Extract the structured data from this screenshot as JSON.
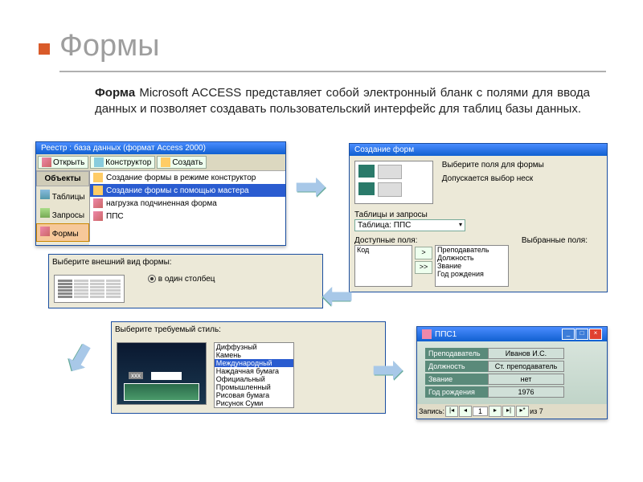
{
  "title": "Формы",
  "desc_bold": "Форма",
  "desc_rest": " Microsoft ACCESS представляет собой электронный бланк с полями для ввода данных и позволяет создавать пользовательский интерфейс для таблиц базы данных.",
  "db": {
    "title": "Реестр : база данных (формат Access 2000)",
    "toolbar": {
      "open": "Открыть",
      "design": "Конструктор",
      "new": "Создать"
    },
    "sidebar": {
      "hdr": "Объекты",
      "tables": "Таблицы",
      "queries": "Запросы",
      "forms": "Формы"
    },
    "list": [
      "Создание формы в режиме конструктор",
      "Создание формы с помощью мастера",
      "нагрузка подчиненная форма",
      "ППС"
    ]
  },
  "wizard": {
    "title": "Создание форм",
    "hint1": "Выберите поля для формы",
    "hint2": "Допускается выбор неск",
    "tbl_lbl": "Таблицы и запросы",
    "tbl_val": "Таблица: ППС",
    "avail": "Доступные поля:",
    "sel": "Выбранные поля:",
    "avail_items": [
      "Код"
    ],
    "sel_items": [
      "Преподаватель",
      "Должность",
      "Звание",
      "Год рождения"
    ]
  },
  "layout": {
    "prompt": "Выберите внешний вид формы:",
    "opt": "в один столбец"
  },
  "style": {
    "prompt": "Выберите требуемый стиль:",
    "items": [
      "Диффузный",
      "Камень",
      "Международный",
      "Наждачная бумага",
      "Официальный",
      "Промышленный",
      "Рисовая бумага",
      "Рисунок Суми"
    ],
    "sel_idx": 2,
    "pv_label": "xxx"
  },
  "form": {
    "title": "ППС1",
    "rows": [
      {
        "label": "Преподаватель",
        "value": "Иванов И.С."
      },
      {
        "label": "Должность",
        "value": "Ст. преподаватель"
      },
      {
        "label": "Звание",
        "value": "нет"
      },
      {
        "label": "Год рождения",
        "value": "1976"
      }
    ],
    "nav": {
      "label": "Запись:",
      "pos": "1",
      "total": "из 7"
    }
  }
}
